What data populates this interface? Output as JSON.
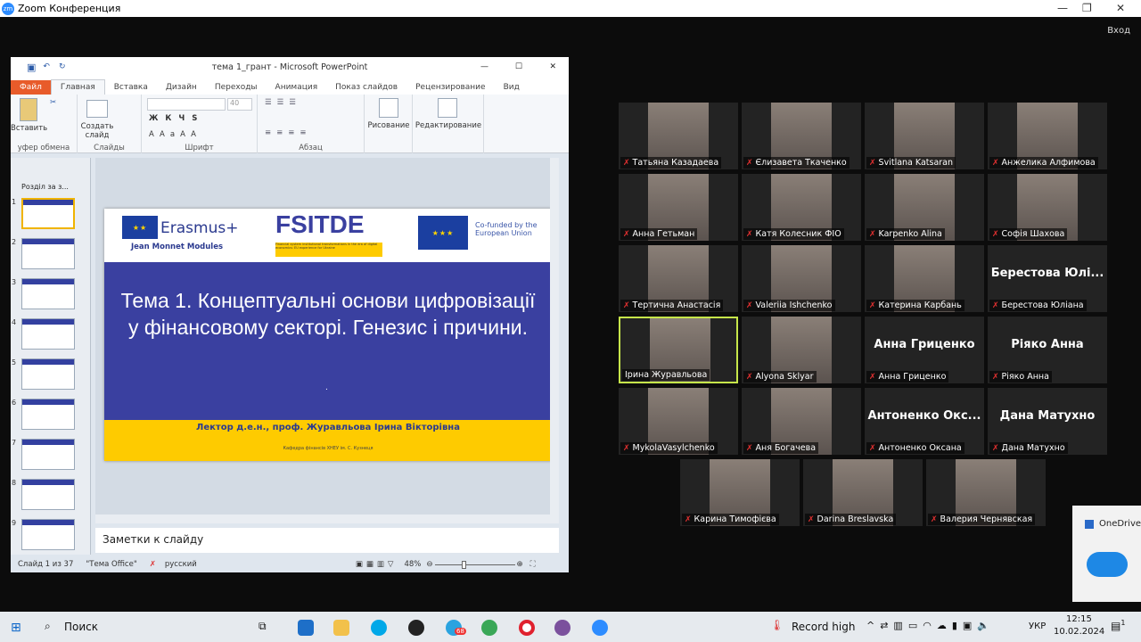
{
  "zoom": {
    "title": "Zoom Конференция",
    "signin": "Вход"
  },
  "ppt": {
    "title": "тема 1_грант  -  Microsoft PowerPoint",
    "tabs": [
      "Файл",
      "Главная",
      "Вставка",
      "Дизайн",
      "Переходы",
      "Анимация",
      "Показ слайдов",
      "Рецензирование",
      "Вид"
    ],
    "ribbon": {
      "paste": "Вставить",
      "clipboard": "уфер обмена",
      "new_slide": "Создать слайд",
      "slides": "Слайды",
      "font_size": "40",
      "font": "Шрифт",
      "paragraph": "Абзац",
      "drawing": "Рисование",
      "editing": "Редактирование"
    },
    "section": "Розділ за з...",
    "thumb_numbers": [
      "1",
      "2",
      "3",
      "4",
      "5",
      "6",
      "7",
      "8",
      "9"
    ],
    "slide": {
      "erasmus": "Erasmus+",
      "jean_monnet": "Jean Monnet Modules",
      "fsitde": "FSITDE",
      "fsitde_sub": "Financial system institutional transformations in the era of digital economics: EU experience for Ukraine",
      "cofunded": "Co-funded by the European Union",
      "title": "Тема 1. Концептуальні основи цифровізації у фінансовому секторі. Генезис і причини.",
      "dot": ".",
      "lecturer": "Лектор  д.е.н., проф. Журавльова Ірина Вікторівна",
      "department": "Кафедра фінансів ХНЕУ ім. С. Кузнеця"
    },
    "notes": "Заметки к слайду",
    "status": {
      "slide": "Слайд 1 из 37",
      "theme": "\"Тема Office\"",
      "lang": "русский",
      "zoom": "48%"
    },
    "zoom_level": 48
  },
  "participants": [
    {
      "name": "Татьяна Казадаева",
      "video": true,
      "muted": true
    },
    {
      "name": "Єлизавета Ткаченко",
      "video": true,
      "muted": true
    },
    {
      "name": "Svitlana Katsaran",
      "video": true,
      "muted": true
    },
    {
      "name": "Анжелика Алфимова",
      "video": true,
      "muted": true
    },
    {
      "name": "Анна Гетьман",
      "video": true,
      "muted": true
    },
    {
      "name": "Катя Колесник ФІО",
      "video": true,
      "muted": true
    },
    {
      "name": "Karpenko Alina",
      "video": true,
      "muted": true
    },
    {
      "name": "Софія Шахова",
      "video": true,
      "muted": true
    },
    {
      "name": "Тертична Анастасія",
      "video": true,
      "muted": true
    },
    {
      "name": "Valeriia Ishchenko",
      "video": true,
      "muted": true
    },
    {
      "name": "Катерина Карбань",
      "video": true,
      "muted": true
    },
    {
      "name": "Берестова Юліана",
      "big": "Берестова  Юлі...",
      "video": false,
      "muted": true
    },
    {
      "name": "Ірина Журавльова",
      "video": true,
      "muted": false,
      "active": true
    },
    {
      "name": "Alyona Sklyar",
      "video": true,
      "muted": true
    },
    {
      "name": "Анна Гриценко",
      "big": "Анна Гриценко",
      "video": false,
      "muted": true
    },
    {
      "name": "Ріяко Анна",
      "big": "Ріяко Анна",
      "video": false,
      "muted": true
    },
    {
      "name": "MykolaVasylchenko",
      "video": true,
      "muted": true
    },
    {
      "name": "Аня Богачева",
      "video": true,
      "muted": true
    },
    {
      "name": "Антоненко Оксана",
      "big": "Антоненко  Окс...",
      "video": false,
      "muted": true
    },
    {
      "name": "Дана Матухно",
      "big": "Дана Матухно",
      "video": false,
      "muted": true
    },
    {
      "name": "Карина Тимофієва",
      "video": true,
      "muted": true
    },
    {
      "name": "Darina Breslavska",
      "video": true,
      "muted": true
    },
    {
      "name": "Валерия Чернявская",
      "video": true,
      "muted": true
    }
  ],
  "onedrive": {
    "label": "OneDrive"
  },
  "taskbar": {
    "search": "Поиск",
    "weather": "Record high",
    "lang": "УКР",
    "time": "12:15",
    "date": "10.02.2024",
    "notifications": "1",
    "telegram_badge": "68"
  },
  "colors": {
    "slide_blue": "#3a40a0",
    "slide_yellow": "#fecb00",
    "active_speaker": "#c6e64a",
    "mute_red": "#e03030"
  }
}
